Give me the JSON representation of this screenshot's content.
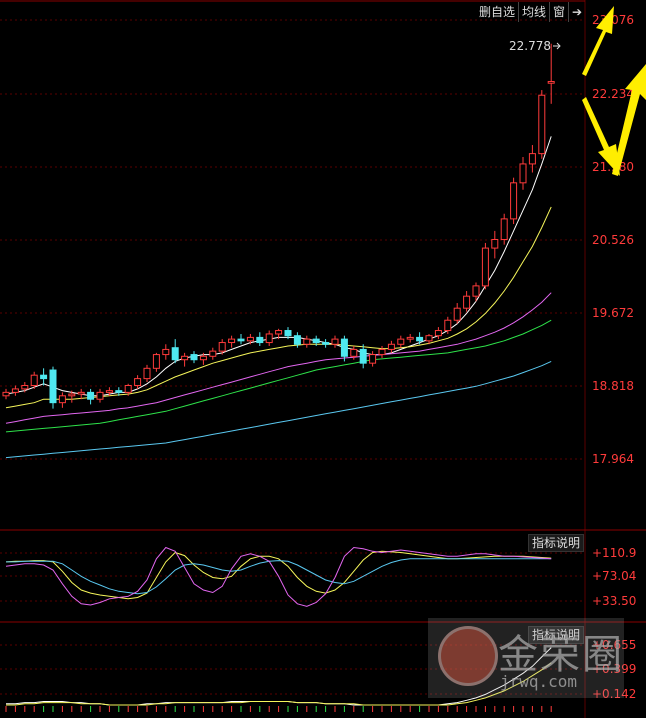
{
  "toolbar": {
    "delete_label": "删自选",
    "ma_label": "均线",
    "window_label": "窗",
    "arrow_label": "➔"
  },
  "main_axis": {
    "tick_labels": [
      "23.076",
      "22.234",
      "21.380",
      "20.526",
      "19.672",
      "18.818",
      "17.964"
    ],
    "last_price_label": "22.778"
  },
  "indicator1": {
    "button_label": "指标说明",
    "tick_labels": [
      "+110.9",
      "+73.04",
      "+33.50"
    ]
  },
  "indicator2": {
    "button_label": "指标说明",
    "tick_labels": [
      "+0.655",
      "+0.399",
      "+0.142"
    ]
  },
  "watermark": {
    "title": "金荣圈",
    "url": "jrwq.com"
  },
  "colors": {
    "background": "#000000",
    "grid": "#5a0000",
    "axis_text": "#ff3b3b",
    "candle_up": "#ff3b3b",
    "candle_down": "#4fe8f0",
    "ma_white": "#ffffff",
    "ma_yellow": "#f5f55a",
    "ma_magenta": "#e266f0",
    "ma_green": "#2ee24a",
    "ma_blue": "#5ac8f0",
    "arrow": "#ffee00"
  },
  "chart_data": {
    "type": "candlestick",
    "ylim": [
      17.4,
      23.2
    ],
    "y_ticks": [
      23.076,
      22.234,
      21.38,
      20.526,
      19.672,
      18.818,
      17.964
    ],
    "last_price": 22.778,
    "candles": [
      [
        18.7,
        18.78,
        18.66,
        18.74
      ],
      [
        18.74,
        18.82,
        18.7,
        18.78
      ],
      [
        18.78,
        18.86,
        18.74,
        18.82
      ],
      [
        18.82,
        18.98,
        18.78,
        18.94
      ],
      [
        18.94,
        19.02,
        18.82,
        18.9
      ],
      [
        19.0,
        19.04,
        18.55,
        18.62
      ],
      [
        18.62,
        18.74,
        18.56,
        18.7
      ],
      [
        18.7,
        18.76,
        18.62,
        18.72
      ],
      [
        18.72,
        18.78,
        18.66,
        18.74
      ],
      [
        18.74,
        18.78,
        18.6,
        18.66
      ],
      [
        18.66,
        18.78,
        18.62,
        18.74
      ],
      [
        18.74,
        18.8,
        18.7,
        18.76
      ],
      [
        18.76,
        18.8,
        18.7,
        18.74
      ],
      [
        18.74,
        18.84,
        18.7,
        18.82
      ],
      [
        18.82,
        18.94,
        18.78,
        18.9
      ],
      [
        18.9,
        19.06,
        18.86,
        19.02
      ],
      [
        19.02,
        19.2,
        18.98,
        19.18
      ],
      [
        19.18,
        19.3,
        19.12,
        19.24
      ],
      [
        19.26,
        19.36,
        19.08,
        19.12
      ],
      [
        19.12,
        19.2,
        19.04,
        19.16
      ],
      [
        19.18,
        19.22,
        19.08,
        19.12
      ],
      [
        19.12,
        19.2,
        19.06,
        19.16
      ],
      [
        19.16,
        19.26,
        19.12,
        19.22
      ],
      [
        19.22,
        19.36,
        19.18,
        19.32
      ],
      [
        19.32,
        19.4,
        19.26,
        19.36
      ],
      [
        19.36,
        19.42,
        19.3,
        19.34
      ],
      [
        19.34,
        19.42,
        19.3,
        19.38
      ],
      [
        19.38,
        19.44,
        19.28,
        19.32
      ],
      [
        19.32,
        19.46,
        19.28,
        19.42
      ],
      [
        19.42,
        19.48,
        19.36,
        19.46
      ],
      [
        19.46,
        19.5,
        19.36,
        19.4
      ],
      [
        19.4,
        19.44,
        19.26,
        19.3
      ],
      [
        19.3,
        19.4,
        19.26,
        19.36
      ],
      [
        19.36,
        19.4,
        19.28,
        19.32
      ],
      [
        19.32,
        19.36,
        19.26,
        19.3
      ],
      [
        19.3,
        19.4,
        19.26,
        19.36
      ],
      [
        19.36,
        19.4,
        19.1,
        19.16
      ],
      [
        19.16,
        19.28,
        19.12,
        19.24
      ],
      [
        19.24,
        19.3,
        19.02,
        19.08
      ],
      [
        19.08,
        19.22,
        19.04,
        19.18
      ],
      [
        19.18,
        19.28,
        19.14,
        19.24
      ],
      [
        19.24,
        19.34,
        19.2,
        19.3
      ],
      [
        19.3,
        19.4,
        19.26,
        19.36
      ],
      [
        19.36,
        19.42,
        19.32,
        19.38
      ],
      [
        19.38,
        19.44,
        19.3,
        19.34
      ],
      [
        19.34,
        19.42,
        19.3,
        19.4
      ],
      [
        19.4,
        19.5,
        19.36,
        19.46
      ],
      [
        19.46,
        19.62,
        19.42,
        19.58
      ],
      [
        19.58,
        19.78,
        19.54,
        19.72
      ],
      [
        19.72,
        19.92,
        19.68,
        19.86
      ],
      [
        19.86,
        20.02,
        19.8,
        19.98
      ],
      [
        19.98,
        20.48,
        19.94,
        20.42
      ],
      [
        20.42,
        20.62,
        20.3,
        20.52
      ],
      [
        20.52,
        20.82,
        20.46,
        20.76
      ],
      [
        20.76,
        21.24,
        20.7,
        21.18
      ],
      [
        21.18,
        21.48,
        21.1,
        21.4
      ],
      [
        21.4,
        21.62,
        21.3,
        21.52
      ],
      [
        21.52,
        22.26,
        21.46,
        22.2
      ],
      [
        22.34,
        22.8,
        22.1,
        22.36
      ]
    ],
    "ma_series": [
      {
        "values": [
          18.72,
          18.74,
          18.76,
          18.8,
          18.84,
          18.8,
          18.76,
          18.74,
          18.72,
          18.7,
          18.7,
          18.72,
          18.74,
          18.74,
          18.78,
          18.84,
          18.92,
          19.02,
          19.1,
          19.14,
          19.16,
          19.18,
          19.18,
          19.2,
          19.24,
          19.28,
          19.32,
          19.34,
          19.36,
          19.38,
          19.38,
          19.38,
          19.36,
          19.34,
          19.32,
          19.3,
          19.26,
          19.24,
          19.2,
          19.18,
          19.18,
          19.2,
          19.24,
          19.28,
          19.32,
          19.36,
          19.4,
          19.46,
          19.54,
          19.66,
          19.8,
          19.98,
          20.16,
          20.38,
          20.62,
          20.86,
          21.1,
          21.4,
          21.72
        ]
      },
      {
        "values": [
          18.56,
          18.58,
          18.6,
          18.62,
          18.66,
          18.66,
          18.66,
          18.66,
          18.67,
          18.68,
          18.69,
          18.7,
          18.71,
          18.72,
          18.74,
          18.77,
          18.82,
          18.87,
          18.92,
          18.96,
          19.0,
          19.04,
          19.08,
          19.11,
          19.14,
          19.17,
          19.2,
          19.22,
          19.24,
          19.26,
          19.28,
          19.29,
          19.3,
          19.3,
          19.3,
          19.3,
          19.29,
          19.28,
          19.27,
          19.26,
          19.25,
          19.25,
          19.26,
          19.27,
          19.29,
          19.31,
          19.34,
          19.37,
          19.42,
          19.48,
          19.56,
          19.66,
          19.78,
          19.92,
          20.08,
          20.26,
          20.44,
          20.66,
          20.9
        ]
      },
      {
        "values": [
          18.38,
          18.4,
          18.42,
          18.44,
          18.46,
          18.47,
          18.48,
          18.49,
          18.5,
          18.51,
          18.52,
          18.53,
          18.55,
          18.56,
          18.58,
          18.6,
          18.62,
          18.65,
          18.68,
          18.71,
          18.74,
          18.77,
          18.8,
          18.83,
          18.86,
          18.89,
          18.92,
          18.95,
          18.98,
          19.01,
          19.04,
          19.06,
          19.08,
          19.1,
          19.12,
          19.13,
          19.14,
          19.15,
          19.16,
          19.17,
          19.18,
          19.19,
          19.2,
          19.21,
          19.22,
          19.24,
          19.26,
          19.28,
          19.3,
          19.33,
          19.36,
          19.4,
          19.44,
          19.49,
          19.55,
          19.62,
          19.7,
          19.79,
          19.9
        ]
      },
      {
        "values": [
          18.28,
          18.29,
          18.3,
          18.31,
          18.32,
          18.33,
          18.34,
          18.35,
          18.36,
          18.37,
          18.38,
          18.4,
          18.42,
          18.44,
          18.46,
          18.48,
          18.5,
          18.52,
          18.55,
          18.58,
          18.61,
          18.64,
          18.67,
          18.7,
          18.73,
          18.76,
          18.79,
          18.82,
          18.85,
          18.88,
          18.91,
          18.94,
          18.97,
          19.0,
          19.02,
          19.04,
          19.06,
          19.08,
          19.1,
          19.12,
          19.13,
          19.14,
          19.15,
          19.16,
          19.17,
          19.18,
          19.19,
          19.2,
          19.22,
          19.24,
          19.26,
          19.28,
          19.31,
          19.34,
          19.38,
          19.42,
          19.47,
          19.52,
          19.58
        ]
      },
      {
        "values": [
          17.98,
          17.99,
          18.0,
          18.01,
          18.02,
          18.03,
          18.04,
          18.05,
          18.06,
          18.07,
          18.08,
          18.09,
          18.1,
          18.11,
          18.12,
          18.13,
          18.14,
          18.15,
          18.17,
          18.19,
          18.21,
          18.23,
          18.25,
          18.27,
          18.29,
          18.31,
          18.33,
          18.35,
          18.37,
          18.39,
          18.41,
          18.43,
          18.45,
          18.47,
          18.49,
          18.51,
          18.53,
          18.55,
          18.57,
          18.59,
          18.61,
          18.63,
          18.65,
          18.67,
          18.69,
          18.71,
          18.73,
          18.75,
          18.77,
          18.79,
          18.81,
          18.84,
          18.87,
          18.9,
          18.93,
          18.97,
          19.01,
          19.05,
          19.1
        ]
      }
    ],
    "indicator1": {
      "ylim": [
        10,
        130
      ],
      "series": [
        {
          "values": [
            95,
            96,
            96,
            97,
            97,
            95,
            80,
            62,
            50,
            45,
            42,
            40,
            38,
            36,
            38,
            45,
            70,
            95,
            110,
            105,
            90,
            78,
            70,
            68,
            72,
            88,
            100,
            104,
            104,
            100,
            88,
            70,
            56,
            48,
            45,
            50,
            62,
            80,
            98,
            110,
            112,
            111,
            110,
            108,
            106,
            104,
            102,
            100,
            100,
            101,
            102,
            103,
            104,
            104,
            104,
            104,
            103,
            102,
            101
          ]
        },
        {
          "values": [
            95,
            95,
            96,
            96,
            96,
            96,
            92,
            82,
            72,
            64,
            58,
            52,
            48,
            46,
            44,
            46,
            55,
            68,
            82,
            90,
            92,
            90,
            86,
            82,
            80,
            82,
            88,
            93,
            96,
            97,
            96,
            90,
            82,
            74,
            66,
            62,
            60,
            64,
            72,
            80,
            88,
            94,
            98,
            100,
            100,
            100,
            100,
            100,
            100,
            100,
            100,
            100,
            100,
            100,
            100,
            100,
            100,
            100,
            100
          ]
        },
        {
          "values": [
            88,
            90,
            92,
            92,
            90,
            82,
            60,
            40,
            28,
            26,
            30,
            36,
            38,
            40,
            48,
            66,
            100,
            118,
            112,
            86,
            60,
            50,
            46,
            56,
            84,
            104,
            108,
            104,
            96,
            72,
            42,
            28,
            24,
            30,
            44,
            70,
            104,
            118,
            116,
            112,
            110,
            112,
            114,
            112,
            110,
            108,
            106,
            104,
            104,
            106,
            108,
            108,
            106,
            104,
            104,
            103,
            102,
            101,
            100
          ]
        }
      ]
    },
    "indicator2": {
      "ylim": [
        0.05,
        0.75
      ],
      "series": [
        {
          "values": [
            0.12,
            0.12,
            0.13,
            0.13,
            0.14,
            0.14,
            0.14,
            0.13,
            0.13,
            0.12,
            0.12,
            0.11,
            0.11,
            0.11,
            0.11,
            0.12,
            0.12,
            0.13,
            0.13,
            0.13,
            0.13,
            0.13,
            0.13,
            0.13,
            0.14,
            0.14,
            0.14,
            0.14,
            0.14,
            0.14,
            0.14,
            0.13,
            0.13,
            0.13,
            0.12,
            0.12,
            0.12,
            0.11,
            0.11,
            0.11,
            0.11,
            0.11,
            0.11,
            0.11,
            0.11,
            0.11,
            0.11,
            0.12,
            0.13,
            0.15,
            0.17,
            0.2,
            0.24,
            0.28,
            0.33,
            0.38,
            0.44,
            0.52,
            0.6
          ]
        },
        {
          "values": [
            0.11,
            0.11,
            0.12,
            0.12,
            0.13,
            0.13,
            0.13,
            0.13,
            0.12,
            0.12,
            0.12,
            0.11,
            0.11,
            0.11,
            0.11,
            0.11,
            0.12,
            0.12,
            0.13,
            0.13,
            0.13,
            0.13,
            0.13,
            0.13,
            0.13,
            0.13,
            0.14,
            0.14,
            0.14,
            0.14,
            0.14,
            0.13,
            0.13,
            0.13,
            0.12,
            0.12,
            0.12,
            0.12,
            0.11,
            0.11,
            0.11,
            0.11,
            0.11,
            0.11,
            0.11,
            0.11,
            0.11,
            0.11,
            0.12,
            0.13,
            0.15,
            0.17,
            0.2,
            0.23,
            0.27,
            0.31,
            0.36,
            0.41,
            0.47
          ]
        }
      ]
    }
  }
}
